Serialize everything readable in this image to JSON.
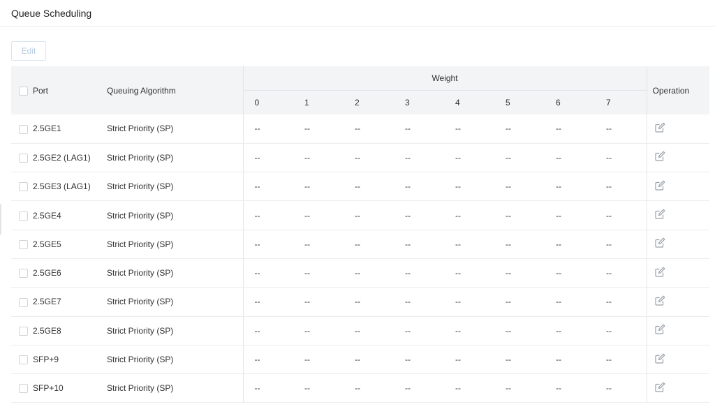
{
  "page": {
    "title": "Queue Scheduling"
  },
  "toolbar": {
    "edit_label": "Edit"
  },
  "table": {
    "headers": {
      "port": "Port",
      "algorithm": "Queuing Algorithm",
      "weight": "Weight",
      "operation": "Operation",
      "weight_columns": [
        "0",
        "1",
        "2",
        "3",
        "4",
        "5",
        "6",
        "7"
      ]
    },
    "rows": [
      {
        "port": "2.5GE1",
        "algorithm": "Strict Priority (SP)",
        "weights": [
          "--",
          "--",
          "--",
          "--",
          "--",
          "--",
          "--",
          "--"
        ]
      },
      {
        "port": "2.5GE2 (LAG1)",
        "algorithm": "Strict Priority (SP)",
        "weights": [
          "--",
          "--",
          "--",
          "--",
          "--",
          "--",
          "--",
          "--"
        ]
      },
      {
        "port": "2.5GE3 (LAG1)",
        "algorithm": "Strict Priority (SP)",
        "weights": [
          "--",
          "--",
          "--",
          "--",
          "--",
          "--",
          "--",
          "--"
        ]
      },
      {
        "port": "2.5GE4",
        "algorithm": "Strict Priority (SP)",
        "weights": [
          "--",
          "--",
          "--",
          "--",
          "--",
          "--",
          "--",
          "--"
        ]
      },
      {
        "port": "2.5GE5",
        "algorithm": "Strict Priority (SP)",
        "weights": [
          "--",
          "--",
          "--",
          "--",
          "--",
          "--",
          "--",
          "--"
        ]
      },
      {
        "port": "2.5GE6",
        "algorithm": "Strict Priority (SP)",
        "weights": [
          "--",
          "--",
          "--",
          "--",
          "--",
          "--",
          "--",
          "--"
        ]
      },
      {
        "port": "2.5GE7",
        "algorithm": "Strict Priority (SP)",
        "weights": [
          "--",
          "--",
          "--",
          "--",
          "--",
          "--",
          "--",
          "--"
        ]
      },
      {
        "port": "2.5GE8",
        "algorithm": "Strict Priority (SP)",
        "weights": [
          "--",
          "--",
          "--",
          "--",
          "--",
          "--",
          "--",
          "--"
        ]
      },
      {
        "port": "SFP+9",
        "algorithm": "Strict Priority (SP)",
        "weights": [
          "--",
          "--",
          "--",
          "--",
          "--",
          "--",
          "--",
          "--"
        ]
      },
      {
        "port": "SFP+10",
        "algorithm": "Strict Priority (SP)",
        "weights": [
          "--",
          "--",
          "--",
          "--",
          "--",
          "--",
          "--",
          "--"
        ]
      }
    ]
  },
  "icons": {
    "row_operation": "edit-icon"
  }
}
